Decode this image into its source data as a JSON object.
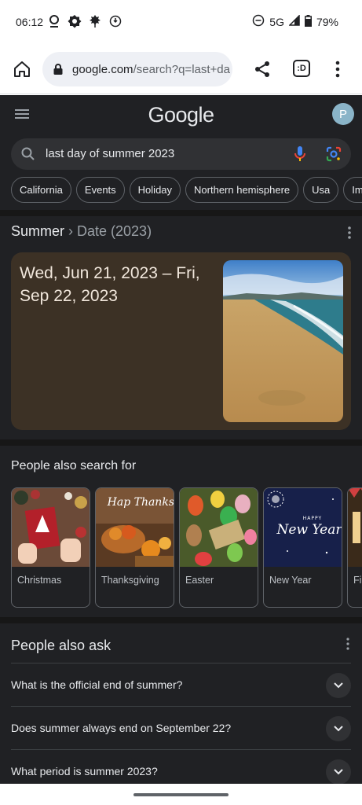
{
  "status_bar": {
    "time": "06:12",
    "network": "5G",
    "battery": "79%",
    "icons": [
      "location-icon",
      "brightness-icon",
      "leaf-icon",
      "data-saver-icon",
      "dnd-icon",
      "signal-icon",
      "battery-icon"
    ]
  },
  "browser": {
    "url_host": "google.com",
    "url_path": "/search?q=last+da",
    "tab_count": ":D"
  },
  "google": {
    "logo": "Google",
    "avatar_initial": "P",
    "query": "last day of summer 2023",
    "chips": [
      "California",
      "Events",
      "Holiday",
      "Northern hemisphere",
      "Usa",
      "Ima"
    ]
  },
  "knowledge_panel": {
    "title": "Summer",
    "breadcrumb": " › Date (2023)",
    "date_range": "Wed, Jun 21, 2023 – Fri, Sep 22, 2023",
    "card_color": "#3c3125"
  },
  "people_also_search": {
    "heading": "People also search for",
    "items": [
      {
        "label": "Christmas"
      },
      {
        "label": "Thanksgiving"
      },
      {
        "label": "Easter"
      },
      {
        "label": "New Year"
      },
      {
        "label": "Fi"
      }
    ],
    "thanksgiving_overlay": "Hap Thanks",
    "newyear_overlay_top": "HAPPY",
    "newyear_overlay": "New Year"
  },
  "people_also_ask": {
    "heading": "People also ask",
    "questions": [
      "What is the official end of summer?",
      "Does summer always end on September 22?",
      "What period is summer 2023?"
    ]
  }
}
